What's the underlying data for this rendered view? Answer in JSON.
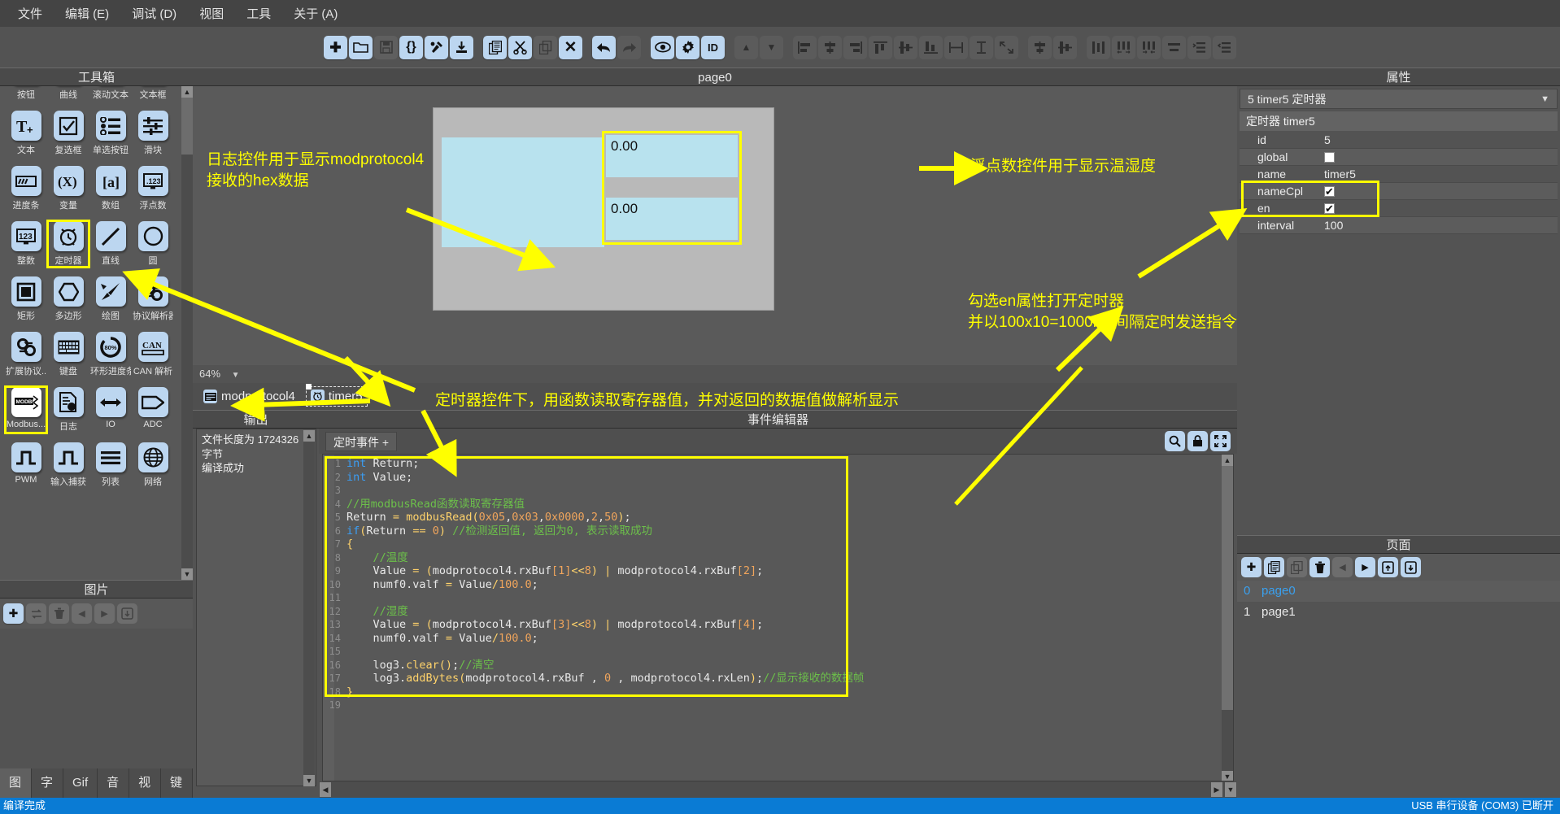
{
  "menubar": {
    "items": [
      {
        "label": "文件"
      },
      {
        "label": "编辑 (E)"
      },
      {
        "label": "调试 (D)"
      },
      {
        "label": "视图"
      },
      {
        "label": "工具"
      },
      {
        "label": "关于 (A)"
      }
    ]
  },
  "toolbar": {
    "buttons": [
      {
        "name": "new-file-button",
        "glyph": "✚",
        "state": "enabled"
      },
      {
        "name": "open-folder-button",
        "glyph": "🗀",
        "state": "enabled"
      },
      {
        "name": "save-button",
        "glyph": "🖫",
        "state": "disabled"
      },
      {
        "name": "braces-button",
        "glyph": "{}",
        "state": "enabled"
      },
      {
        "name": "build-button",
        "glyph": "⚒",
        "state": "enabled"
      },
      {
        "name": "download-button",
        "glyph": "⭳",
        "state": "enabled"
      },
      {
        "name": "paste-button",
        "glyph": "🗐",
        "state": "enabled"
      },
      {
        "name": "cut-button",
        "glyph": "✂",
        "state": "enabled"
      },
      {
        "name": "copy-button",
        "glyph": "⧉",
        "state": "disabled"
      },
      {
        "name": "delete-button",
        "glyph": "✕",
        "state": "enabled"
      },
      {
        "name": "undo-button",
        "glyph": "↰",
        "state": "enabled"
      },
      {
        "name": "redo-button",
        "glyph": "↱",
        "state": "disabled"
      },
      {
        "name": "preview-eye-button",
        "glyph": "👁",
        "state": "enabled"
      },
      {
        "name": "settings-gear-button",
        "glyph": "✿",
        "state": "enabled"
      },
      {
        "name": "id-button",
        "glyph": "ID",
        "state": "enabled"
      },
      {
        "name": "move-up-button",
        "glyph": "▲",
        "state": "disabled"
      },
      {
        "name": "move-down-button",
        "glyph": "▼",
        "state": "disabled"
      },
      {
        "name": "align-left-button",
        "glyph": "⊫",
        "state": "disabled"
      },
      {
        "name": "align-center-h-button",
        "glyph": "⌸",
        "state": "disabled"
      },
      {
        "name": "align-right-button",
        "glyph": "⊨",
        "state": "disabled"
      },
      {
        "name": "align-top-button",
        "glyph": "⊤",
        "state": "disabled"
      },
      {
        "name": "align-middle-v-button",
        "glyph": "⌼",
        "state": "disabled"
      },
      {
        "name": "align-bottom-button",
        "glyph": "⊥",
        "state": "disabled"
      },
      {
        "name": "same-width-button",
        "glyph": "↔",
        "state": "disabled"
      },
      {
        "name": "same-height-button",
        "glyph": "↕",
        "state": "disabled"
      },
      {
        "name": "same-size-button",
        "glyph": "⤢",
        "state": "disabled"
      },
      {
        "name": "center-h-button",
        "glyph": "⌸",
        "state": "disabled"
      },
      {
        "name": "center-v-button",
        "glyph": "⌼",
        "state": "disabled"
      },
      {
        "name": "distribute-h-button",
        "glyph": "⫿",
        "state": "disabled"
      },
      {
        "name": "distribute-expand-button",
        "glyph": "⫼",
        "state": "disabled"
      },
      {
        "name": "distribute-shrink-button",
        "glyph": "⫼",
        "state": "disabled"
      },
      {
        "name": "equal-gap-button",
        "glyph": "≡",
        "state": "disabled"
      },
      {
        "name": "indent-increase-button",
        "glyph": "⇥",
        "state": "disabled"
      },
      {
        "name": "indent-decrease-button",
        "glyph": "⇤",
        "state": "disabled"
      }
    ]
  },
  "toolbox": {
    "title": "工具箱",
    "items": [
      {
        "label": "按钮",
        "icon": "button-icon",
        "selected": false
      },
      {
        "label": "曲线",
        "icon": "curve-icon",
        "selected": false
      },
      {
        "label": "滚动文本",
        "icon": "scroll-text-icon",
        "selected": false
      },
      {
        "label": "文本框",
        "icon": "textbox-icon",
        "selected": false
      },
      {
        "label": "文本",
        "icon": "text-plus-icon",
        "selected": false
      },
      {
        "label": "复选框",
        "icon": "checkbox-icon",
        "selected": false
      },
      {
        "label": "单选按钮",
        "icon": "radio-list-icon",
        "selected": false
      },
      {
        "label": "滑块",
        "icon": "slider-icon",
        "selected": false
      },
      {
        "label": "进度条",
        "icon": "progressbar-icon",
        "selected": false
      },
      {
        "label": "变量",
        "icon": "variable-icon",
        "selected": false
      },
      {
        "label": "数组",
        "icon": "array-icon",
        "selected": false
      },
      {
        "label": "浮点数",
        "icon": "float-number-icon",
        "selected": false
      },
      {
        "label": "整数",
        "icon": "integer-icon",
        "selected": false
      },
      {
        "label": "定时器",
        "icon": "timer-clock-icon",
        "selected": true
      },
      {
        "label": "直线",
        "icon": "line-icon",
        "selected": false
      },
      {
        "label": "圆",
        "icon": "circle-icon",
        "selected": false
      },
      {
        "label": "矩形",
        "icon": "rectangle-icon",
        "selected": false
      },
      {
        "label": "多边形",
        "icon": "polygon-icon",
        "selected": false
      },
      {
        "label": "绘图",
        "icon": "draw-pen-icon",
        "selected": false
      },
      {
        "label": "协议解析器",
        "icon": "protocol-parser-icon",
        "selected": false
      },
      {
        "label": "扩展协议...",
        "icon": "extended-protocol-icon",
        "selected": false
      },
      {
        "label": "键盘",
        "icon": "keyboard-icon",
        "selected": false
      },
      {
        "label": "环形进度条",
        "icon": "ring-progress-icon",
        "selected": false
      },
      {
        "label": "CAN 解析",
        "icon": "can-parser-icon",
        "selected": false
      },
      {
        "label": "Modbus...",
        "icon": "modbus-icon",
        "selected": true
      },
      {
        "label": "日志",
        "icon": "log-icon",
        "selected": false
      },
      {
        "label": "IO",
        "icon": "io-arrow-icon",
        "selected": false
      },
      {
        "label": "ADC",
        "icon": "adc-icon",
        "selected": false
      },
      {
        "label": "PWM",
        "icon": "pwm-icon",
        "selected": false
      },
      {
        "label": "输入捕获",
        "icon": "input-capture-icon",
        "selected": false
      },
      {
        "label": "列表",
        "icon": "list-icon",
        "selected": false
      },
      {
        "label": "网络",
        "icon": "network-globe-icon",
        "selected": false
      }
    ]
  },
  "images_panel": {
    "title": "图片",
    "buttons": [
      {
        "name": "add-image-button",
        "glyph": "✚",
        "state": "enabled"
      },
      {
        "name": "replace-image-button",
        "glyph": "⇄",
        "state": "disabled"
      },
      {
        "name": "delete-image-button",
        "glyph": "🗑",
        "state": "disabled"
      },
      {
        "name": "prev-image-button",
        "glyph": "◀",
        "state": "disabled"
      },
      {
        "name": "next-image-button",
        "glyph": "▶",
        "state": "disabled"
      },
      {
        "name": "export-image-button",
        "glyph": "⤓",
        "state": "disabled"
      }
    ]
  },
  "asset_tabs": {
    "items": [
      {
        "label": "图片",
        "active": true
      },
      {
        "label": "字体",
        "active": false
      },
      {
        "label": "Gif",
        "active": false
      },
      {
        "label": "音频",
        "active": false
      },
      {
        "label": "视频",
        "active": false
      },
      {
        "label": "键盘",
        "active": false
      }
    ]
  },
  "canvas": {
    "title": "page0",
    "zoom": "64%",
    "float_value_1": "0.00",
    "float_value_2": "0.00"
  },
  "widget_tabs": {
    "items": [
      {
        "label": "modprotocol4",
        "icon": "modbus-widget-icon",
        "selected": false
      },
      {
        "label": "timer5",
        "icon": "timer-widget-icon",
        "selected": true
      }
    ]
  },
  "output": {
    "title": "输出",
    "lines": [
      "文件长度为 1724326 字节",
      "编译成功"
    ]
  },
  "event_editor": {
    "title": "事件编辑器",
    "tab_label": "定时事件 +",
    "buttons": [
      {
        "name": "find-icon",
        "glyph": "🔍"
      },
      {
        "name": "lock-icon",
        "glyph": "🔒"
      },
      {
        "name": "fullscreen-icon",
        "glyph": "⛶"
      }
    ],
    "code_lines": [
      {
        "n": "1",
        "tokens": [
          {
            "t": "int",
            "c": "kw"
          },
          {
            "t": " Return;",
            "c": "id"
          }
        ]
      },
      {
        "n": "2",
        "tokens": [
          {
            "t": "int",
            "c": "kw"
          },
          {
            "t": " Value;",
            "c": "id"
          }
        ]
      },
      {
        "n": "3",
        "tokens": []
      },
      {
        "n": "4",
        "tokens": [
          {
            "t": "//用modbusRead函数读取寄存器值",
            "c": "cm"
          }
        ]
      },
      {
        "n": "5",
        "tokens": [
          {
            "t": "Return ",
            "c": "id"
          },
          {
            "t": "=",
            "c": "op"
          },
          {
            "t": " ",
            "c": "id"
          },
          {
            "t": "modbusRead",
            "c": "fn"
          },
          {
            "t": "(",
            "c": "pn"
          },
          {
            "t": "0x05",
            "c": "num"
          },
          {
            "t": ",",
            "c": "id"
          },
          {
            "t": "0x03",
            "c": "num"
          },
          {
            "t": ",",
            "c": "id"
          },
          {
            "t": "0x0000",
            "c": "num"
          },
          {
            "t": ",",
            "c": "id"
          },
          {
            "t": "2",
            "c": "num"
          },
          {
            "t": ",",
            "c": "id"
          },
          {
            "t": "50",
            "c": "num"
          },
          {
            "t": ")",
            "c": "pn"
          },
          {
            "t": ";",
            "c": "id"
          }
        ]
      },
      {
        "n": "6",
        "tokens": [
          {
            "t": "if",
            "c": "kw"
          },
          {
            "t": "(",
            "c": "pn"
          },
          {
            "t": "Return ",
            "c": "id"
          },
          {
            "t": "==",
            "c": "op"
          },
          {
            "t": " ",
            "c": "id"
          },
          {
            "t": "0",
            "c": "num"
          },
          {
            "t": ")",
            "c": "pn"
          },
          {
            "t": " ",
            "c": "id"
          },
          {
            "t": "//检测返回值, 返回为0, 表示读取成功",
            "c": "cm"
          }
        ]
      },
      {
        "n": "7",
        "tokens": [
          {
            "t": "{",
            "c": "pn"
          }
        ]
      },
      {
        "n": "8",
        "tokens": [
          {
            "t": "    ",
            "c": "id"
          },
          {
            "t": "//温度",
            "c": "cm"
          }
        ]
      },
      {
        "n": "9",
        "tokens": [
          {
            "t": "    Value ",
            "c": "id"
          },
          {
            "t": "=",
            "c": "op"
          },
          {
            "t": " ",
            "c": "id"
          },
          {
            "t": "(",
            "c": "pn"
          },
          {
            "t": "modprotocol4.rxBuf",
            "c": "id"
          },
          {
            "t": "[",
            "c": "num"
          },
          {
            "t": "1",
            "c": "num"
          },
          {
            "t": "]",
            "c": "num"
          },
          {
            "t": "<<",
            "c": "op"
          },
          {
            "t": "8",
            "c": "num"
          },
          {
            "t": ")",
            "c": "pn"
          },
          {
            "t": " ",
            "c": "id"
          },
          {
            "t": "|",
            "c": "op"
          },
          {
            "t": " modprotocol4.rxBuf",
            "c": "id"
          },
          {
            "t": "[",
            "c": "num"
          },
          {
            "t": "2",
            "c": "num"
          },
          {
            "t": "]",
            "c": "num"
          },
          {
            "t": ";",
            "c": "id"
          }
        ]
      },
      {
        "n": "10",
        "tokens": [
          {
            "t": "    numf0.valf ",
            "c": "id"
          },
          {
            "t": "=",
            "c": "op"
          },
          {
            "t": " Value",
            "c": "id"
          },
          {
            "t": "/",
            "c": "op"
          },
          {
            "t": "100.0",
            "c": "num"
          },
          {
            "t": ";",
            "c": "id"
          }
        ]
      },
      {
        "n": "11",
        "tokens": []
      },
      {
        "n": "12",
        "tokens": [
          {
            "t": "    ",
            "c": "id"
          },
          {
            "t": "//湿度",
            "c": "cm"
          }
        ]
      },
      {
        "n": "13",
        "tokens": [
          {
            "t": "    Value ",
            "c": "id"
          },
          {
            "t": "=",
            "c": "op"
          },
          {
            "t": " ",
            "c": "id"
          },
          {
            "t": "(",
            "c": "pn"
          },
          {
            "t": "modprotocol4.rxBuf",
            "c": "id"
          },
          {
            "t": "[",
            "c": "num"
          },
          {
            "t": "3",
            "c": "num"
          },
          {
            "t": "]",
            "c": "num"
          },
          {
            "t": "<<",
            "c": "op"
          },
          {
            "t": "8",
            "c": "num"
          },
          {
            "t": ")",
            "c": "pn"
          },
          {
            "t": " ",
            "c": "id"
          },
          {
            "t": "|",
            "c": "op"
          },
          {
            "t": " modprotocol4.rxBuf",
            "c": "id"
          },
          {
            "t": "[",
            "c": "num"
          },
          {
            "t": "4",
            "c": "num"
          },
          {
            "t": "]",
            "c": "num"
          },
          {
            "t": ";",
            "c": "id"
          }
        ]
      },
      {
        "n": "14",
        "tokens": [
          {
            "t": "    numf0.valf ",
            "c": "id"
          },
          {
            "t": "=",
            "c": "op"
          },
          {
            "t": " Value",
            "c": "id"
          },
          {
            "t": "/",
            "c": "op"
          },
          {
            "t": "100.0",
            "c": "num"
          },
          {
            "t": ";",
            "c": "id"
          }
        ]
      },
      {
        "n": "15",
        "tokens": []
      },
      {
        "n": "16",
        "tokens": [
          {
            "t": "    log3.",
            "c": "id"
          },
          {
            "t": "clear",
            "c": "fn"
          },
          {
            "t": "()",
            "c": "pn"
          },
          {
            "t": ";",
            "c": "id"
          },
          {
            "t": "//清空",
            "c": "cm"
          }
        ]
      },
      {
        "n": "17",
        "tokens": [
          {
            "t": "    log3.",
            "c": "id"
          },
          {
            "t": "addBytes",
            "c": "fn"
          },
          {
            "t": "(",
            "c": "pn"
          },
          {
            "t": "modprotocol4.rxBuf , ",
            "c": "id"
          },
          {
            "t": "0",
            "c": "num"
          },
          {
            "t": " , modprotocol4.rxLen",
            "c": "id"
          },
          {
            "t": ")",
            "c": "pn"
          },
          {
            "t": ";",
            "c": "id"
          },
          {
            "t": "//显示接收的数据帧",
            "c": "cm"
          }
        ]
      },
      {
        "n": "18",
        "tokens": [
          {
            "t": "}",
            "c": "pn"
          }
        ]
      },
      {
        "n": "19",
        "tokens": []
      }
    ]
  },
  "properties": {
    "title": "属性",
    "selector": "5  timer5  定时器",
    "group_header": "定时器 timer5",
    "rows": [
      {
        "key": "id",
        "value": "5",
        "type": "text"
      },
      {
        "key": "global",
        "value": "",
        "type": "checkbox",
        "checked": false
      },
      {
        "key": "name",
        "value": "timer5",
        "type": "text"
      },
      {
        "key": "nameCpl",
        "value": "",
        "type": "checkbox",
        "checked": true
      },
      {
        "key": "en",
        "value": "",
        "type": "checkbox",
        "checked": true
      },
      {
        "key": "interval",
        "value": "100",
        "type": "text"
      }
    ]
  },
  "pages": {
    "title": "页面",
    "buttons": [
      {
        "name": "add-page-button",
        "glyph": "✚",
        "state": "enabled"
      },
      {
        "name": "duplicate-page-button",
        "glyph": "🗐",
        "state": "enabled"
      },
      {
        "name": "copy-page-button",
        "glyph": "⧉",
        "state": "disabled"
      },
      {
        "name": "delete-page-button",
        "glyph": "🗑",
        "state": "enabled"
      },
      {
        "name": "prev-page-button",
        "glyph": "◀",
        "state": "disabled"
      },
      {
        "name": "next-page-button",
        "glyph": "▶",
        "state": "enabled"
      },
      {
        "name": "import-page-button",
        "glyph": "⤴",
        "state": "enabled"
      },
      {
        "name": "export-page-button",
        "glyph": "⤵",
        "state": "enabled"
      }
    ],
    "items": [
      {
        "index": "0",
        "label": "page0",
        "selected": true
      },
      {
        "index": "1",
        "label": "page1",
        "selected": false
      }
    ]
  },
  "statusbar": {
    "left": "编译完成",
    "right": "USB 串行设备 (COM3) 已断开"
  },
  "annotations": {
    "log_note": "日志控件用于显示modprotocol4\n接收的hex数据",
    "float_note": "浮点数控件用于显示温湿度",
    "timer_note": "勾选en属性打开定时器\n并以100x10=1000ms间隔定时发送指令",
    "code_note": "定时器控件下，用函数读取寄存器值，并对返回的数据值做解析显示"
  },
  "colors": {
    "accent_yellow": "#ffff00",
    "panel_bg": "#535353",
    "icon_blue": "#bcd6f0",
    "status_blue": "#0a7bd4",
    "widget_cyan": "#b8e2ee"
  }
}
